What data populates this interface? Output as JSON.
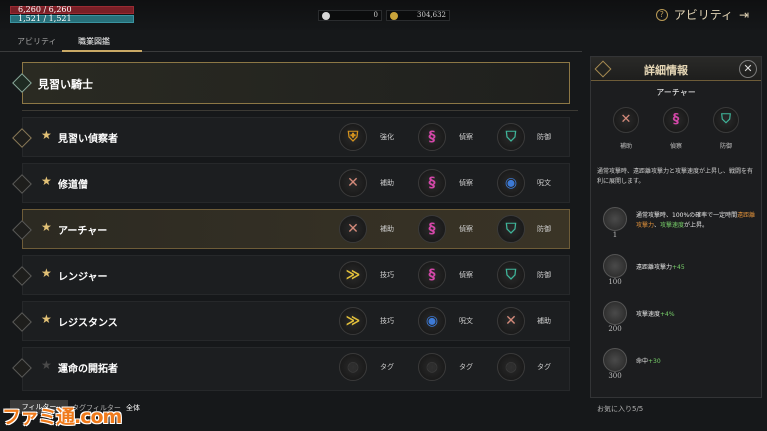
{
  "status": {
    "hp": "6,260 / 6,260",
    "mp": "1,521 / 1,521"
  },
  "currency": {
    "gems": "0",
    "gold": "304,632"
  },
  "topright": {
    "label": "アビリティ"
  },
  "tabs": [
    {
      "label": "アビリティ"
    },
    {
      "label": "職業図鑑"
    }
  ],
  "header": {
    "title": "見習い騎士"
  },
  "rows": [
    {
      "name": "見習い偵察者",
      "traits": [
        {
          "label": "強化",
          "icon": "gold-shield-icon"
        },
        {
          "label": "偵察",
          "icon": "pink-serpent-icon"
        },
        {
          "label": "防御",
          "icon": "teal-shield-icon"
        }
      ]
    },
    {
      "name": "修道僧",
      "traits": [
        {
          "label": "補助",
          "icon": "salmon-support-icon"
        },
        {
          "label": "偵察",
          "icon": "pink-serpent-icon"
        },
        {
          "label": "呪文",
          "icon": "blue-spell-icon"
        }
      ]
    },
    {
      "name": "アーチャー",
      "traits": [
        {
          "label": "補助",
          "icon": "salmon-support-icon"
        },
        {
          "label": "偵察",
          "icon": "pink-serpent-icon"
        },
        {
          "label": "防御",
          "icon": "teal-shield-icon"
        }
      ]
    },
    {
      "name": "レンジャー",
      "traits": [
        {
          "label": "技巧",
          "icon": "yellow-wing-icon"
        },
        {
          "label": "偵察",
          "icon": "pink-serpent-icon"
        },
        {
          "label": "防御",
          "icon": "teal-shield-icon"
        }
      ]
    },
    {
      "name": "レジスタンス",
      "traits": [
        {
          "label": "技巧",
          "icon": "yellow-wing-icon"
        },
        {
          "label": "呪文",
          "icon": "blue-spell-icon"
        },
        {
          "label": "補助",
          "icon": "salmon-support-icon"
        }
      ]
    },
    {
      "name": "運命の開拓者",
      "traits": [
        {
          "label": "タグ",
          "icon": "empty-tag-icon"
        },
        {
          "label": "タグ",
          "icon": "empty-tag-icon"
        },
        {
          "label": "タグ",
          "icon": "empty-tag-icon"
        }
      ]
    }
  ],
  "bottom": {
    "filter": "フィルター",
    "tagfilter": "タグフィルター",
    "tagvalue": "全体",
    "favorites": "お気に入り5/5"
  },
  "watermark": "ファミ通.com",
  "panel": {
    "title": "詳細情報",
    "job": "アーチャー",
    "traits": [
      {
        "label": "補助"
      },
      {
        "label": "偵察"
      },
      {
        "label": "防御"
      }
    ],
    "description": "通常攻撃時、遠距離攻撃力と攻撃速度が上昇し、戦闘を有利に展開します。",
    "levels": [
      {
        "level": "1",
        "pre": "通常攻撃時、100%の確率で一定時間",
        "hl1": "遠距離攻撃力",
        "mid": "、",
        "hl2": "攻撃速度",
        "post": "が上昇。"
      },
      {
        "level": "100",
        "pre": "遠距離攻撃力",
        "hl2": "+45"
      },
      {
        "level": "200",
        "pre": "攻撃速度",
        "hl2": "+4%"
      },
      {
        "level": "300",
        "pre": "命中",
        "hl2": "+30"
      }
    ]
  }
}
